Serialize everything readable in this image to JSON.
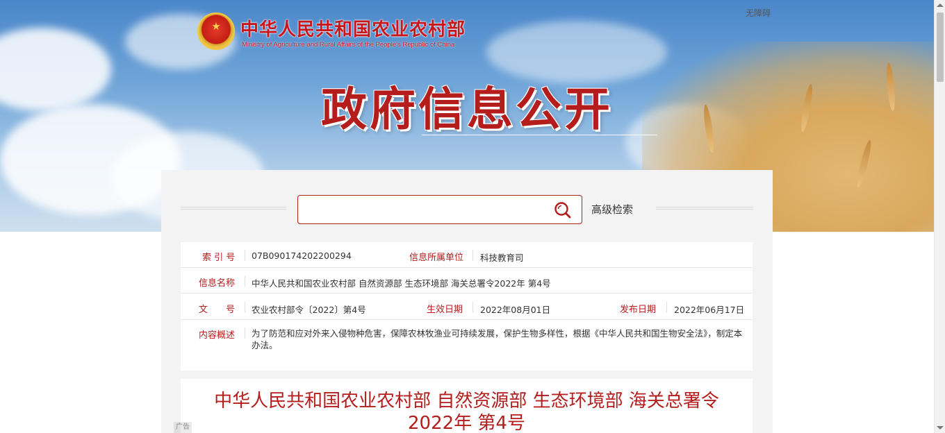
{
  "header": {
    "ministry_cn": "中华人民共和国农业农村部",
    "ministry_en": "Ministry of Agriculture and Rural Affairs of the People's Republic of China",
    "accessibility": "无障碍",
    "title": "政府信息公开"
  },
  "search": {
    "placeholder": "",
    "value": "",
    "advanced_label": "高级检索"
  },
  "info": {
    "index_label": "索 引 号",
    "index_value": "07B090174202200294",
    "unit_label": "信息所属单位",
    "unit_value": "科技教育司",
    "name_label": "信息名称",
    "name_value": "中华人民共和国农业农村部 自然资源部 生态环境部 海关总署令2022年 第4号",
    "doc_no_label": "文　　号",
    "doc_no_value": "农业农村部令〔2022〕第4号",
    "effective_label": "生效日期",
    "effective_value": "2022年08月01日",
    "publish_label": "发布日期",
    "publish_value": "2022年06月17日",
    "summary_label": "内容概述",
    "summary_value": "为了防范和应对外来入侵物种危害，保障农林牧渔业可持续发展，保护生物多样性，根据《中华人民共和国生物安全法》，制定本办法。"
  },
  "document": {
    "title_line1": "中华人民共和国农业农村部 自然资源部 生态环境部 海关总署令",
    "title_line2": "2022年 第4号"
  },
  "ad_label": "广告",
  "colors": {
    "accent_red": "#b51d1d",
    "sky_blue": "#4a86c9",
    "wheat": "#d9a85c"
  },
  "icons": {
    "search": "search-icon",
    "emblem": "national-emblem-icon"
  }
}
